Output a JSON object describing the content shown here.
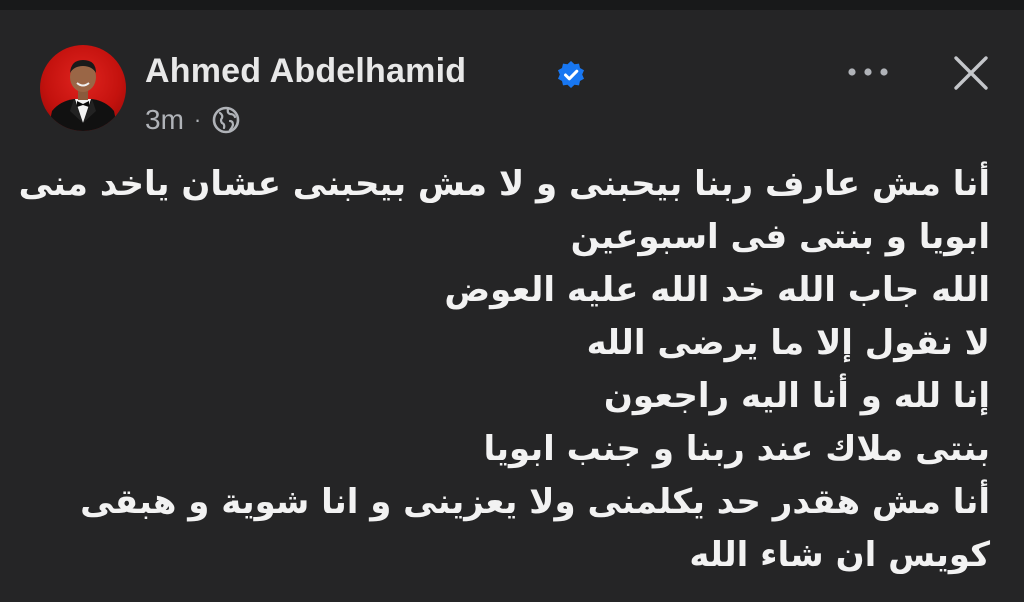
{
  "post": {
    "author": {
      "name": "Ahmed Abdelhamid",
      "verified": true,
      "avatar_icon": "profile-photo-man-in-tuxedo"
    },
    "timestamp": "3m",
    "separator": "·",
    "audience_icon": "globe-icon",
    "body_lines": [
      "أنا مش عارف ربنا بيحبنى و لا مش بيحبنى عشان ياخد منى",
      "ابويا و بنتى فى اسبوعين",
      "الله جاب الله خد الله عليه العوض",
      "لا نقول إلا ما يرضى الله",
      "إنا لله و أنا اليه راجعون",
      "بنتى ملاك عند ربنا و جنب ابويا",
      "أنا مش هقدر حد يكلمنى ولا يعزينى و انا شوية و هبقى",
      "كويس ان شاء الله"
    ]
  },
  "toolbar": {
    "more_icon": "more-horizontal-icon",
    "close_icon": "close-icon"
  },
  "colors": {
    "background": "#252526",
    "text": "#e4e6eb",
    "secondary_text": "#b0b3b8",
    "verified_badge": "#1877f2",
    "avatar_background": "#d11a15"
  }
}
